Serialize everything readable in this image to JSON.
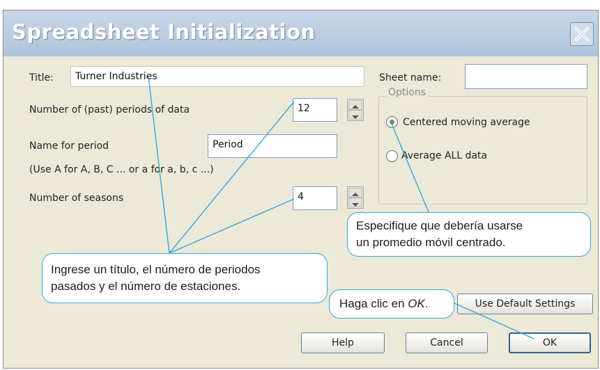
{
  "dialog": {
    "title": "Spreadsheet Initialization"
  },
  "form": {
    "title_label": "Title:",
    "title_value": "Turner Industries",
    "periods_label": "Number of (past) periods of data",
    "periods_value": "12",
    "period_name_label": "Name for period",
    "period_name_value": "Period",
    "period_hint": "(Use A for A, B, C ... or a for a, b, c ...)",
    "seasons_label": "Number of seasons",
    "seasons_value": "4",
    "sheet_name_label": "Sheet name:",
    "sheet_name_value": ""
  },
  "options": {
    "group_title": "Options",
    "centered_label": "Centered moving average",
    "average_all_label": "Average ALL data",
    "selected": "centered"
  },
  "buttons": {
    "default_settings": "Use Default Settings",
    "help": "Help",
    "cancel": "Cancel",
    "ok": "OK"
  },
  "callouts": {
    "inputs_line1": "Ingrese un título, el número de periodos",
    "inputs_line2": "pasados y el número de estaciones.",
    "option_line1": "Especifique que debería usarse",
    "option_line2": "un promedio móvil centrado.",
    "ok_text_prefix": "Haga clic en ",
    "ok_text_em": "OK",
    "ok_text_suffix": "."
  },
  "colors": {
    "callout_border": "#33a8d8",
    "dialog_bg": "#ece9d8",
    "titlebar": "#b8cade"
  },
  "icons": {
    "close": "close-icon",
    "spin_up": "spin-up-icon",
    "spin_down": "spin-down-icon"
  }
}
